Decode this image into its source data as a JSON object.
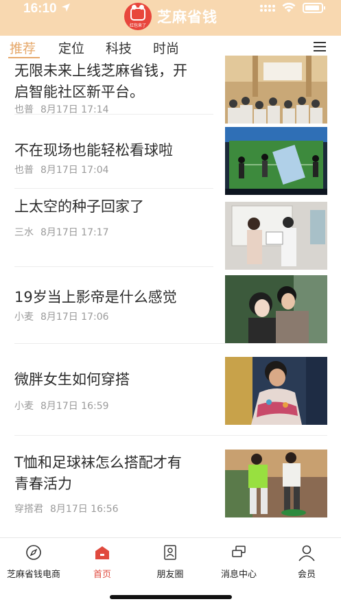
{
  "status_bar": {
    "time": "16:10"
  },
  "brand": {
    "logo_text": "红包来了",
    "name": "芝麻省钱"
  },
  "tabs": [
    {
      "label": "推荐",
      "active": true
    },
    {
      "label": "定位",
      "active": false
    },
    {
      "label": "科技",
      "active": false
    },
    {
      "label": "时尚",
      "active": false
    }
  ],
  "articles": [
    {
      "title_line1": "无限未来上线芝麻省钱，开",
      "title_line2": "启智能社区新平台。",
      "author": "也普",
      "date": "8月17日 17:14",
      "thumb": "conference-photo"
    },
    {
      "title_line1": "不在现场也能轻松看球啦",
      "title_line2": "",
      "author": "也普",
      "date": "8月17日 17:04",
      "thumb": "soccer-vr-photo"
    },
    {
      "title_line1": "上太空的种子回家了",
      "title_line2": "",
      "author": "三水",
      "date": "8月17日 17:17",
      "thumb": "award-ceremony-photo"
    },
    {
      "title_line1": "19岁当上影帝是什么感觉",
      "title_line2": "",
      "author": "小麦",
      "date": "8月17日 17:06",
      "thumb": "couple-photo"
    },
    {
      "title_line1": "微胖女生如何穿搭",
      "title_line2": "",
      "author": "小麦",
      "date": "8月17日 16:59",
      "thumb": "woman-dress-photo"
    },
    {
      "title_line1": "T恤和足球袜怎么搭配才有",
      "title_line2": "青春活力",
      "author": "穿搭君",
      "date": "8月17日 16:56",
      "thumb": "street-fashion-photo"
    }
  ],
  "bottom_nav": [
    {
      "label": "芝麻省钱电商",
      "icon": "compass-icon",
      "active": false
    },
    {
      "label": "首页",
      "icon": "home-icon",
      "active": true
    },
    {
      "label": "朋友圈",
      "icon": "contacts-icon",
      "active": false
    },
    {
      "label": "消息中心",
      "icon": "message-icon",
      "active": false
    },
    {
      "label": "会员",
      "icon": "user-icon",
      "active": false
    }
  ],
  "colors": {
    "header_bg": "#f8d8b0",
    "accent": "#e6a86a",
    "active_nav": "#e04a3e"
  }
}
